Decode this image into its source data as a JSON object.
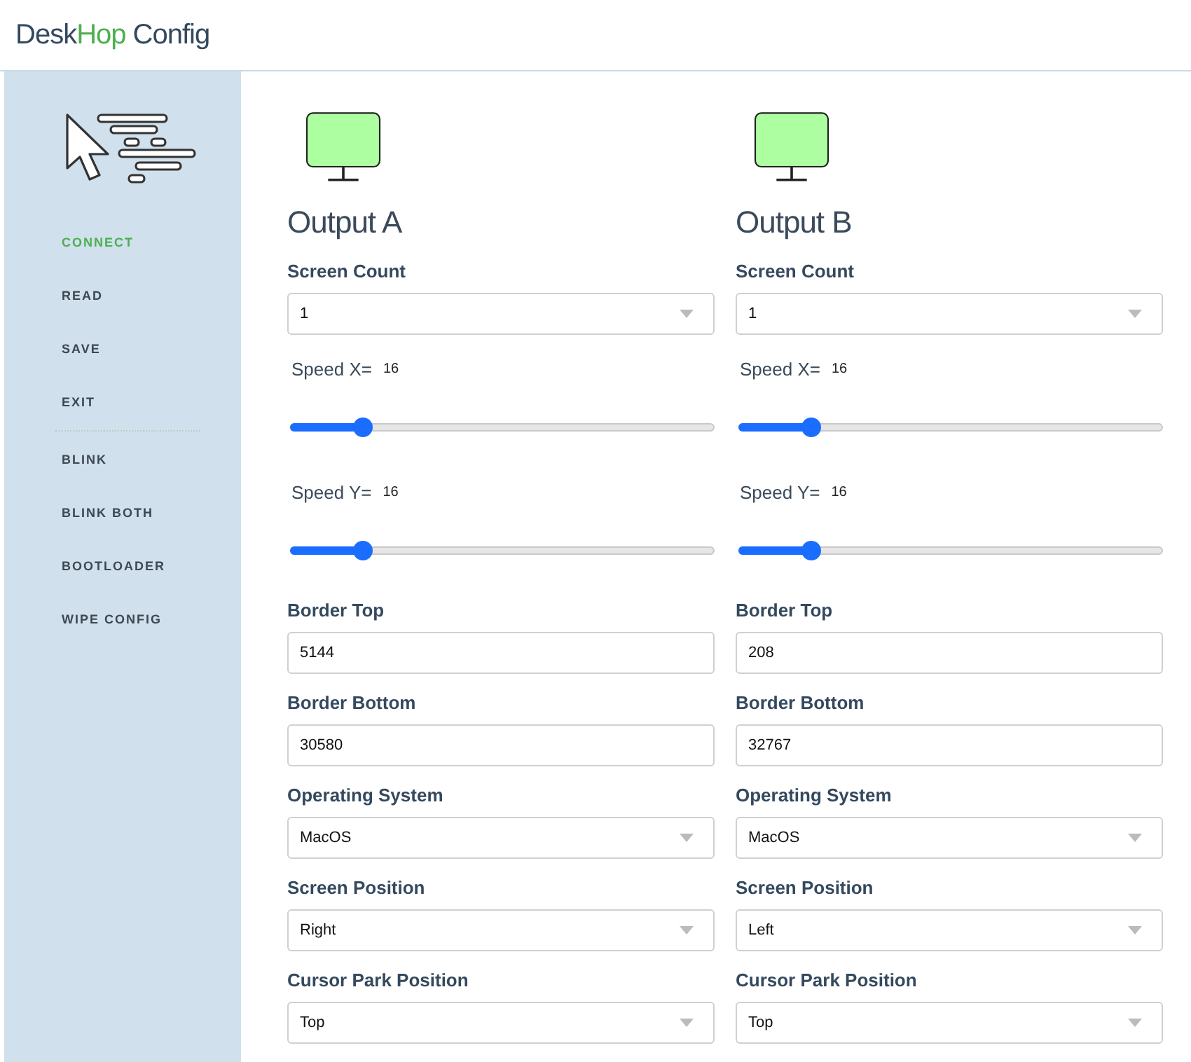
{
  "app_title": [
    {
      "text": "Desk",
      "accent": false
    },
    {
      "text": "Hop",
      "accent": true
    },
    {
      "text": "Config",
      "accent": false
    }
  ],
  "sidebar": {
    "groups": [
      [
        {
          "label": "CONNECT",
          "selected": true
        },
        {
          "label": "READ",
          "selected": false
        },
        {
          "label": "SAVE",
          "selected": false
        },
        {
          "label": "EXIT",
          "selected": false
        }
      ],
      [
        {
          "label": "BLINK",
          "selected": false
        },
        {
          "label": "BLINK BOTH",
          "selected": false
        },
        {
          "label": "BOOTLOADER",
          "selected": false
        },
        {
          "label": "WIPE CONFIG",
          "selected": false
        }
      ]
    ]
  },
  "outputs": [
    {
      "title": "Output A",
      "fields": [
        {
          "kind": "select",
          "label": "Screen Count",
          "value": "1"
        },
        {
          "kind": "slider",
          "label": "Speed X=",
          "reading": "16",
          "level": 0.17
        },
        {
          "kind": "slider",
          "label": "Speed Y=",
          "reading": "16",
          "level": 0.17
        },
        {
          "kind": "input",
          "label": "Border Top",
          "value": "5144"
        },
        {
          "kind": "input",
          "label": "Border Bottom",
          "value": "30580"
        },
        {
          "kind": "select",
          "label": "Operating System",
          "value": "MacOS"
        },
        {
          "kind": "select",
          "label": "Screen Position",
          "value": "Right"
        },
        {
          "kind": "select",
          "label": "Cursor Park Position",
          "value": "Top"
        }
      ]
    },
    {
      "title": "Output B",
      "fields": [
        {
          "kind": "select",
          "label": "Screen Count",
          "value": "1"
        },
        {
          "kind": "slider",
          "label": "Speed X=",
          "reading": "16",
          "level": 0.17
        },
        {
          "kind": "slider",
          "label": "Speed Y=",
          "reading": "16",
          "level": 0.17
        },
        {
          "kind": "input",
          "label": "Border Top",
          "value": "208"
        },
        {
          "kind": "input",
          "label": "Border Bottom",
          "value": "32767"
        },
        {
          "kind": "select",
          "label": "Operating System",
          "value": "MacOS"
        },
        {
          "kind": "select",
          "label": "Screen Position",
          "value": "Left"
        },
        {
          "kind": "select",
          "label": "Cursor Park Position",
          "value": "Top"
        }
      ]
    }
  ]
}
